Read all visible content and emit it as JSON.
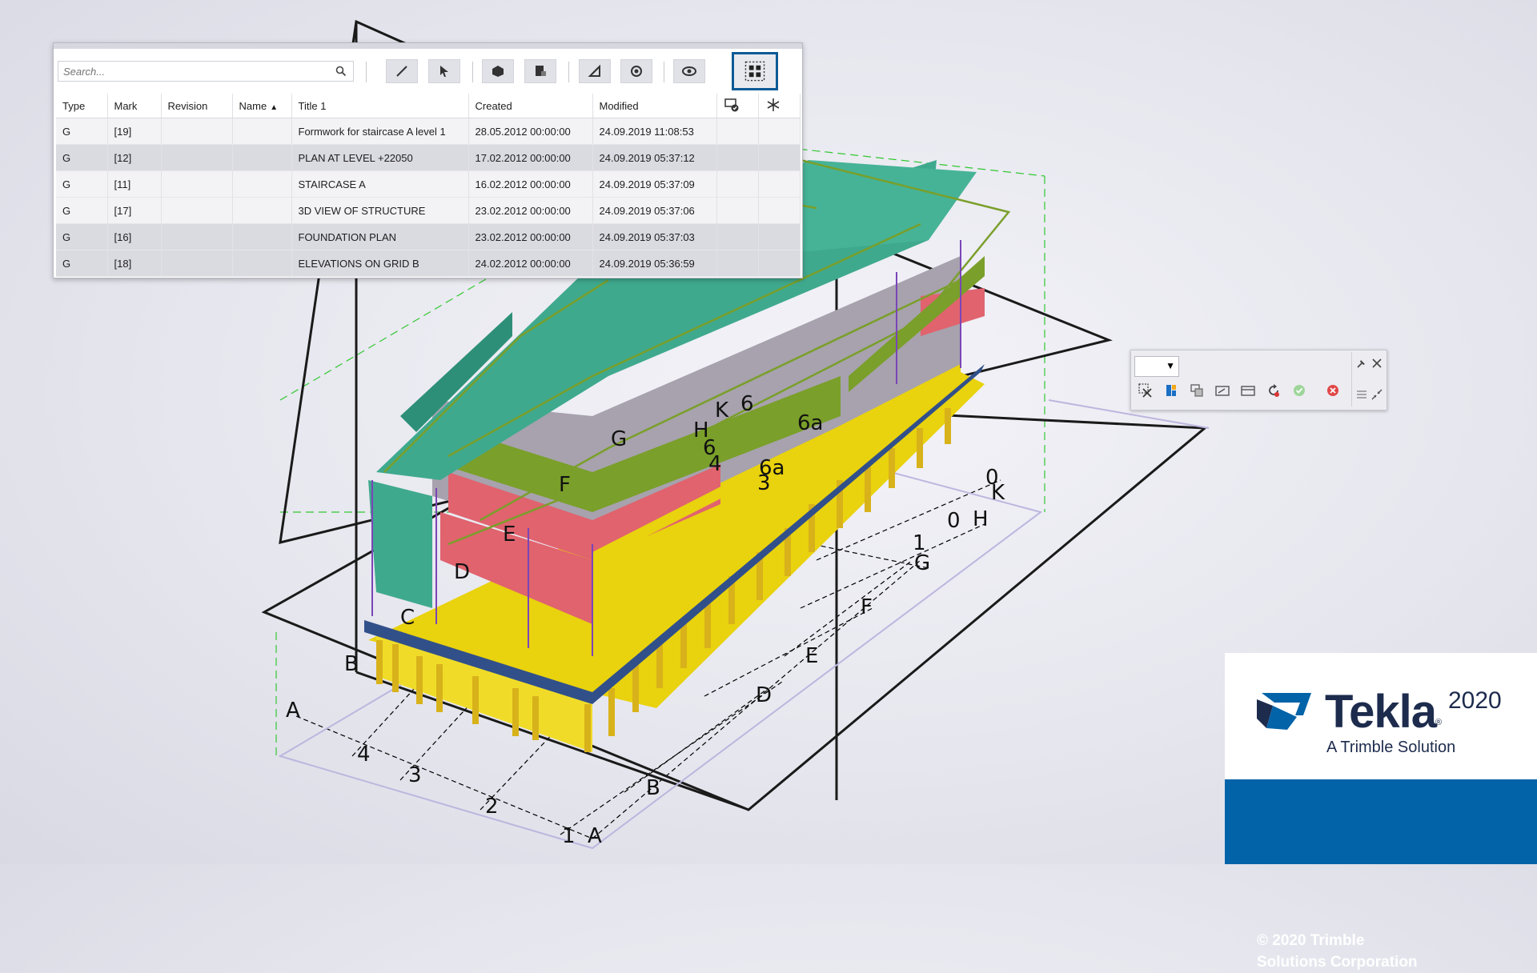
{
  "search": {
    "placeholder": "Search..."
  },
  "toolbar": {
    "buttons": [
      "pencil-icon",
      "select-icon",
      "cube-icon",
      "drawing-icon",
      "edit-drawing-icon",
      "rotate-icon",
      "eye-icon",
      "grid-icon"
    ]
  },
  "table": {
    "columns": [
      "Type",
      "Mark",
      "Revision",
      "Name",
      "Title 1",
      "Created",
      "Modified"
    ],
    "sort_column": "Name",
    "rows": [
      {
        "type": "G",
        "mark": "[19]",
        "revision": "",
        "name": "",
        "title": "Formwork for staircase A level 1",
        "created": "28.05.2012 00:00:00",
        "modified": "24.09.2019 11:08:53"
      },
      {
        "type": "G",
        "mark": "[12]",
        "revision": "",
        "name": "",
        "title": "PLAN AT LEVEL +22050",
        "created": "17.02.2012 00:00:00",
        "modified": "24.09.2019 05:37:12"
      },
      {
        "type": "G",
        "mark": "[11]",
        "revision": "",
        "name": "",
        "title": "STAIRCASE A",
        "created": "16.02.2012 00:00:00",
        "modified": "24.09.2019 05:37:09"
      },
      {
        "type": "G",
        "mark": "[17]",
        "revision": "",
        "name": "",
        "title": "3D VIEW OF STRUCTURE",
        "created": "23.02.2012 00:00:00",
        "modified": "24.09.2019 05:37:06"
      },
      {
        "type": "G",
        "mark": "[16]",
        "revision": "",
        "name": "",
        "title": "FOUNDATION PLAN",
        "created": "23.02.2012 00:00:00",
        "modified": "24.09.2019 05:37:03"
      },
      {
        "type": "G",
        "mark": "[18]",
        "revision": "",
        "name": "",
        "title": "ELEVATIONS ON GRID B",
        "created": "24.02.2012 00:00:00",
        "modified": "24.09.2019 05:36:59"
      }
    ]
  },
  "model": {
    "grid_labels": {
      "g": "G",
      "f": "F",
      "e": "E",
      "d": "D",
      "c": "C",
      "b": "B",
      "a": "A",
      "h": "H",
      "k": "K",
      "six_a": "6",
      "six_b": "6",
      "six_a_label": "6a",
      "six_a_label2": "6a",
      "four_a": "4",
      "three_a": "3",
      "four_b": "4",
      "three_b": "3",
      "two": "2",
      "one_a": "1",
      "zero_k": "0",
      "zero_h": "0",
      "h2": "H",
      "k2": "K",
      "one_g": "1",
      "g2": "G",
      "f2": "F",
      "e2": "E",
      "d2": "D",
      "b2": "B",
      "a2": "A"
    },
    "colors": {
      "roof": "#3fa98e",
      "red": "#e0636e",
      "yellow": "#e9d20e",
      "green": "#7a9f2a",
      "purple": "#7a45b8",
      "blue": "#31508a"
    }
  },
  "floatbar": {
    "dropdown_value": "",
    "icons": [
      "scissors-icon",
      "color-icon",
      "copy-icon",
      "edit-icon",
      "panel-icon",
      "refresh-icon",
      "check-icon",
      "cancel-icon"
    ]
  },
  "brand": {
    "name": "Tekla",
    "registered": "®",
    "year": "2020",
    "tagline": "A Trimble Solution",
    "copyright_line1": "© 2020 Trimble",
    "copyright_line2": "Solutions Corporation"
  }
}
